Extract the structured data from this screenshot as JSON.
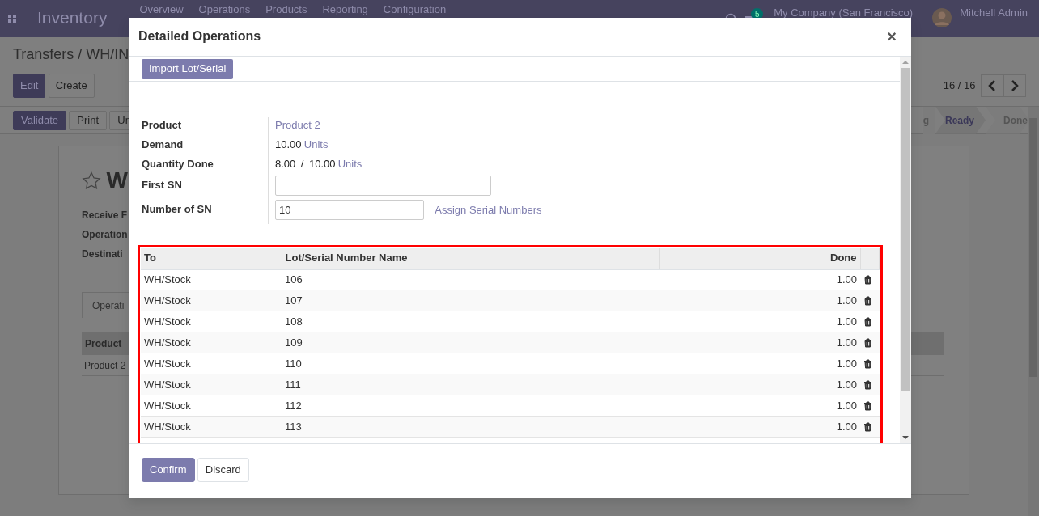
{
  "navbar": {
    "app": "Inventory",
    "menu": [
      "Overview",
      "Operations",
      "Products",
      "Reporting",
      "Configuration"
    ],
    "message_count": "5",
    "company": "My Company (San Francisco)",
    "user": "Mitchell Admin"
  },
  "breadcrumb": "Transfers / WH/IN",
  "control_buttons": [
    "Edit",
    "Create"
  ],
  "pager": "16 / 16",
  "action_buttons": [
    "Validate",
    "Print",
    "Un"
  ],
  "stages": [
    {
      "label": "g",
      "selected": false
    },
    {
      "label": "Ready",
      "selected": true
    },
    {
      "label": "Done",
      "selected": false
    }
  ],
  "sheet": {
    "title": "W",
    "fields": [
      "Receive F",
      "Operation",
      "Destinati"
    ],
    "tab": "Operati",
    "table_header": "Product",
    "rows": [
      "Product 2"
    ]
  },
  "dialog": {
    "title": "Detailed Operations",
    "close": "×",
    "import_button": "Import Lot/Serial",
    "fields": [
      {
        "kind": "link",
        "label": "Product",
        "value": "Product 2"
      },
      {
        "kind": "text",
        "label": "Demand",
        "value": "10.00",
        "unit": "Units"
      },
      {
        "kind": "ratio",
        "label": "Quantity Done",
        "value": "8.00",
        "separator": "/",
        "total": "10.00",
        "unit": "Units"
      },
      {
        "kind": "input",
        "label": "First SN"
      },
      {
        "kind": "input",
        "label": "Number of SN",
        "value": "10",
        "action": "Assign Serial Numbers"
      }
    ],
    "table": {
      "columns": [
        "To",
        "Lot/Serial Number Name",
        "Done"
      ],
      "rows": [
        {
          "to": "WH/Stock",
          "lot": "106",
          "done": "1.00"
        },
        {
          "to": "WH/Stock",
          "lot": "107",
          "done": "1.00"
        },
        {
          "to": "WH/Stock",
          "lot": "108",
          "done": "1.00"
        },
        {
          "to": "WH/Stock",
          "lot": "109",
          "done": "1.00"
        },
        {
          "to": "WH/Stock",
          "lot": "110",
          "done": "1.00"
        },
        {
          "to": "WH/Stock",
          "lot": "111",
          "done": "1.00"
        },
        {
          "to": "WH/Stock",
          "lot": "112",
          "done": "1.00"
        },
        {
          "to": "WH/Stock",
          "lot": "113",
          "done": "1.00"
        }
      ]
    },
    "buttons": [
      "Confirm",
      "Discard"
    ]
  }
}
